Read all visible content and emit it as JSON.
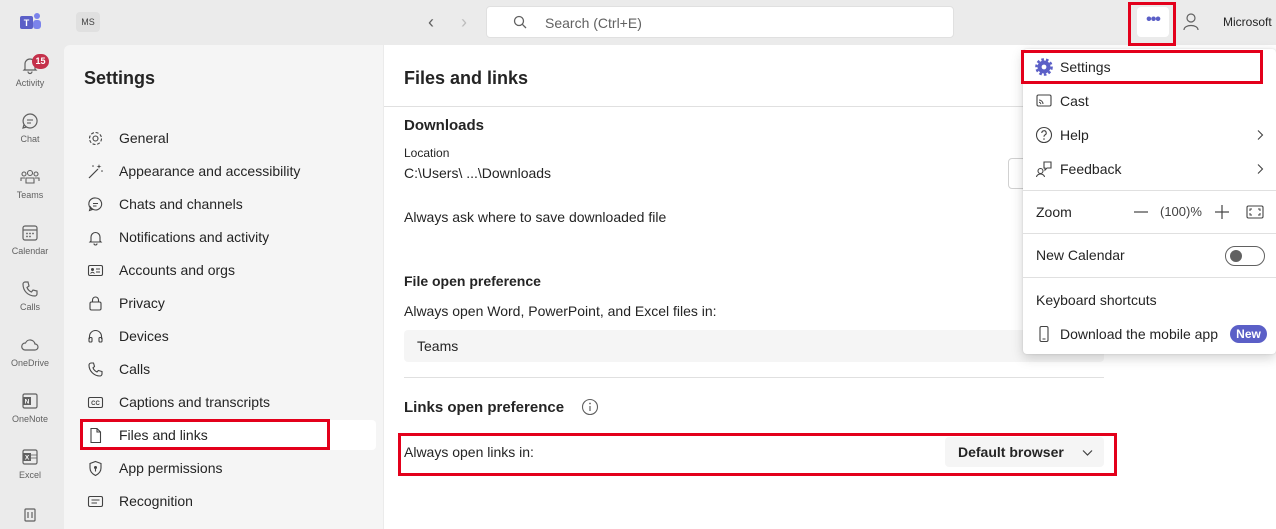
{
  "topbar": {
    "org_badge": "MS",
    "search_placeholder": "Search (Ctrl+E)",
    "more_label": "•••",
    "org_name": "Microsoft"
  },
  "rail": {
    "activity_badge": "15",
    "items": [
      {
        "label": "Activity",
        "icon": "bell-icon"
      },
      {
        "label": "Chat",
        "icon": "chat-icon"
      },
      {
        "label": "Teams",
        "icon": "teams-icon"
      },
      {
        "label": "Calendar",
        "icon": "calendar-icon"
      },
      {
        "label": "Calls",
        "icon": "phone-icon"
      },
      {
        "label": "OneDrive",
        "icon": "cloud-icon"
      },
      {
        "label": "OneNote",
        "icon": "onenote-icon"
      },
      {
        "label": "Excel",
        "icon": "excel-icon"
      },
      {
        "label": "",
        "icon": "apps-icon"
      }
    ]
  },
  "settings": {
    "title": "Settings",
    "items": [
      {
        "label": "General",
        "icon": "gear-icon"
      },
      {
        "label": "Appearance and accessibility",
        "icon": "wand-icon"
      },
      {
        "label": "Chats and channels",
        "icon": "chat-icon"
      },
      {
        "label": "Notifications and activity",
        "icon": "bell-icon"
      },
      {
        "label": "Accounts and orgs",
        "icon": "id-card-icon"
      },
      {
        "label": "Privacy",
        "icon": "lock-icon"
      },
      {
        "label": "Devices",
        "icon": "headset-icon"
      },
      {
        "label": "Calls",
        "icon": "phone-icon"
      },
      {
        "label": "Captions and transcripts",
        "icon": "cc-icon"
      },
      {
        "label": "Files and links",
        "icon": "file-icon"
      },
      {
        "label": "App permissions",
        "icon": "shield-icon"
      },
      {
        "label": "Recognition",
        "icon": "recognition-icon"
      }
    ],
    "active_index": 9
  },
  "main": {
    "title": "Files and links",
    "downloads": {
      "heading": "Downloads",
      "location_label": "Location",
      "location_value": "C:\\Users\\          ...\\Downloads",
      "ask_label": "Always ask where to save downloaded file"
    },
    "file_open": {
      "heading": "File open preference",
      "subtitle": "Always open Word, PowerPoint, and Excel files in:",
      "value": "Teams"
    },
    "links_open": {
      "heading": "Links open preference",
      "row_label": "Always open links in:",
      "value": "Default browser"
    }
  },
  "menu": {
    "settings": "Settings",
    "cast": "Cast",
    "help": "Help",
    "feedback": "Feedback",
    "zoom_label": "Zoom",
    "zoom_value": "(100)%",
    "new_calendar": "New Calendar",
    "new_calendar_on": false,
    "keyboard_shortcuts": "Keyboard shortcuts",
    "download_mobile": "Download the mobile app",
    "new_badge": "New"
  },
  "colors": {
    "accent": "#5b5fc7",
    "highlight": "#e3001b",
    "badge": "#c4314b"
  }
}
